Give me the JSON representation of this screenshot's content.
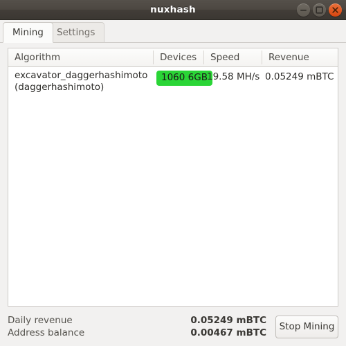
{
  "window": {
    "title": "nuxhash",
    "controls": [
      {
        "name": "minimize-button",
        "glyph": "minimize-icon"
      },
      {
        "name": "maximize-button",
        "glyph": "maximize-icon"
      },
      {
        "name": "close-button",
        "glyph": "close-icon",
        "color": "#dd4814"
      }
    ]
  },
  "tabs": [
    {
      "label": "Mining",
      "active": true
    },
    {
      "label": "Settings",
      "active": false
    }
  ],
  "table": {
    "columns": [
      {
        "key": "algorithm",
        "label": "Algorithm"
      },
      {
        "key": "devices",
        "label": "Devices"
      },
      {
        "key": "speed",
        "label": "Speed"
      },
      {
        "key": "revenue",
        "label": "Revenue"
      }
    ],
    "rows": [
      {
        "algorithm_line1": "excavator_daggerhashimoto",
        "algorithm_line2": "(daggerhashimoto)",
        "devices": "1060 6GB",
        "devices_badge_color": "#2ad536",
        "speed": "19.58 MH/s",
        "revenue": "0.05249 mBTC"
      }
    ]
  },
  "footer": {
    "daily_revenue_label": "Daily revenue",
    "daily_revenue_value": "0.05249 mBTC",
    "address_balance_label": "Address balance",
    "address_balance_value": "0.00467 mBTC",
    "action_button_label": "Stop Mining"
  }
}
